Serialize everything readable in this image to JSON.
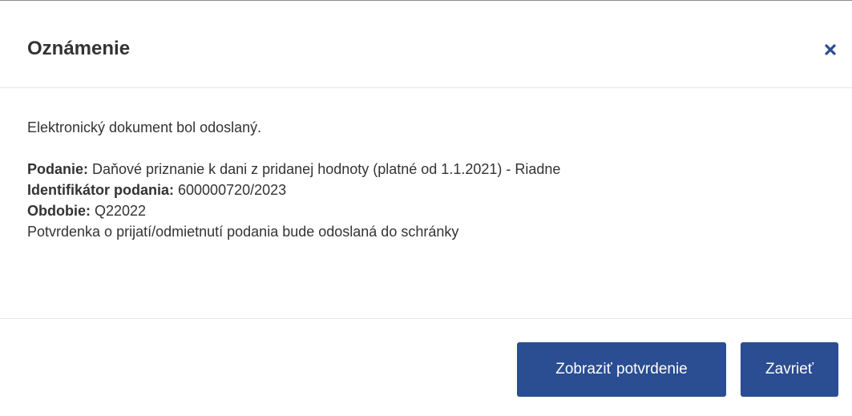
{
  "dialog": {
    "title": "Oznámenie",
    "close_icon": "close-icon",
    "accent_color": "#2b4d91"
  },
  "body": {
    "intro": "Elektronický dokument bol odoslaný.",
    "submission_label": "Podanie:",
    "submission_value": " Daňové priznanie k dani z pridanej hodnoty (platné od 1.1.2021) - Riadne",
    "submission_id_label": "Identifikátor podania:",
    "submission_id_value": " 600000720/2023",
    "period_label": "Obdobie:",
    "period_value": " Q22022",
    "receipt_note": "Potvrdenka o prijatí/odmietnutí podania bude odoslaná do schránky"
  },
  "footer": {
    "show_confirmation_label": "Zobraziť potvrdenie",
    "close_label": "Zavrieť"
  }
}
